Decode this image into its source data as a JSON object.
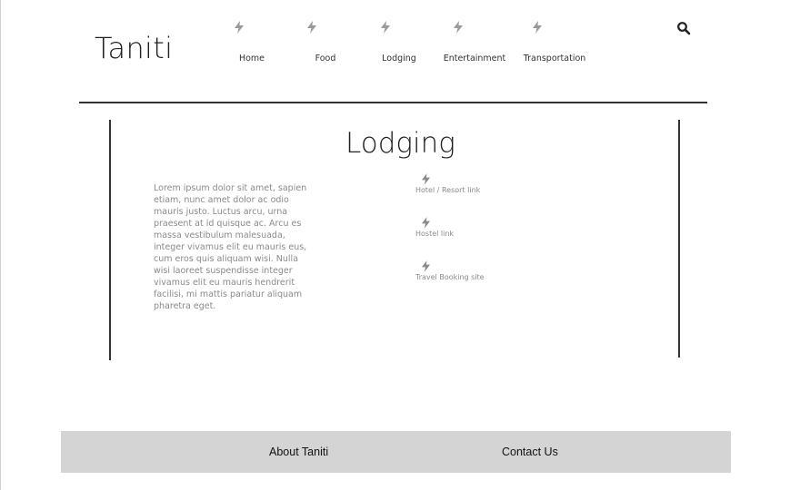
{
  "brand": {
    "logo_text": "Taniti"
  },
  "nav": {
    "items": [
      {
        "label": "Home",
        "icon": "lightning-icon"
      },
      {
        "label": "Food",
        "icon": "lightning-icon"
      },
      {
        "label": "Lodging",
        "icon": "lightning-icon"
      },
      {
        "label": "Entertainment",
        "icon": "lightning-icon"
      },
      {
        "label": "Transportation",
        "icon": "lightning-icon"
      }
    ],
    "search_icon": "search-icon"
  },
  "main": {
    "title": "Lodging",
    "body": "Lorem ipsum dolor sit amet, sapien etiam, nunc amet dolor ac odio mauris justo. Luctus arcu, urna praesent at id quisque ac. Arcu es massa vestibulum malesuada, integer vivamus elit eu mauris eus, cum eros quis aliquam wisi. Nulla wisi laoreet suspendisse integer vivamus elit eu mauris hendrerit facilisi, mi mattis pariatur aliquam pharetra eget.",
    "links": [
      {
        "label": "Hotel / Resort link",
        "icon": "lightning-icon"
      },
      {
        "label": "Hostel link",
        "icon": "lightning-icon"
      },
      {
        "label": "Travel Booking site",
        "icon": "lightning-icon"
      }
    ]
  },
  "footer": {
    "about_label": "About Taniti",
    "contact_label": "Contact Us"
  },
  "colors": {
    "text": "#222222",
    "muted_text": "#8a8a8a",
    "icon": "#9a9a9a",
    "footer_bg": "#d4d4d4",
    "rule": "#333333"
  }
}
